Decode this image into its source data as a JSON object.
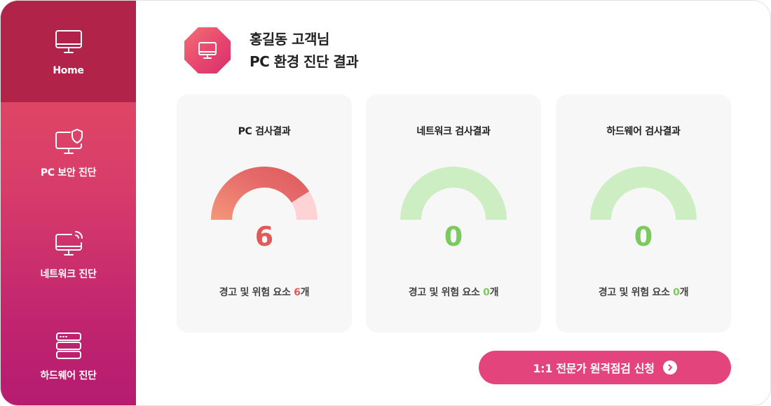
{
  "sidebar": {
    "items": [
      {
        "label": "Home",
        "icon": "monitor-icon",
        "active": true
      },
      {
        "label": "PC 보안 진단",
        "icon": "monitor-shield-icon",
        "active": false
      },
      {
        "label": "네트워크 진단",
        "icon": "monitor-wifi-icon",
        "active": false
      },
      {
        "label": "하드웨어 진단",
        "icon": "server-icon",
        "active": false
      }
    ]
  },
  "header": {
    "line1": "홍길동 고객님",
    "line2": "PC 환경 진단 결과",
    "icon": "monitor-icon"
  },
  "cards": [
    {
      "title": "PC 검사결과",
      "value": "6",
      "footer_prefix": "경고 및 위험 요소 ",
      "footer_count": "6",
      "footer_suffix": "개",
      "warning_fraction": 0.82,
      "color": "#e05a5a"
    },
    {
      "title": "네트워크 검사결과",
      "value": "0",
      "footer_prefix": "경고 및 위험 요소 ",
      "footer_count": "0",
      "footer_suffix": "개",
      "warning_fraction": 0,
      "color": "#7cc95f"
    },
    {
      "title": "하드웨어 검사결과",
      "value": "0",
      "footer_prefix": "경고 및 위험 요소 ",
      "footer_count": "0",
      "footer_suffix": "개",
      "warning_fraction": 0,
      "color": "#7cc95f"
    }
  ],
  "cta": {
    "label": "1:1 전문가 원격점검 신청",
    "icon": "chevron-right-circle-icon"
  },
  "colors": {
    "sidebar_active": "#b2234a",
    "accent": "#e4447c",
    "danger": "#e05a5a",
    "safe": "#7cc95f",
    "safe_track": "#cdedc2",
    "danger_track": "#fdd3d6"
  }
}
